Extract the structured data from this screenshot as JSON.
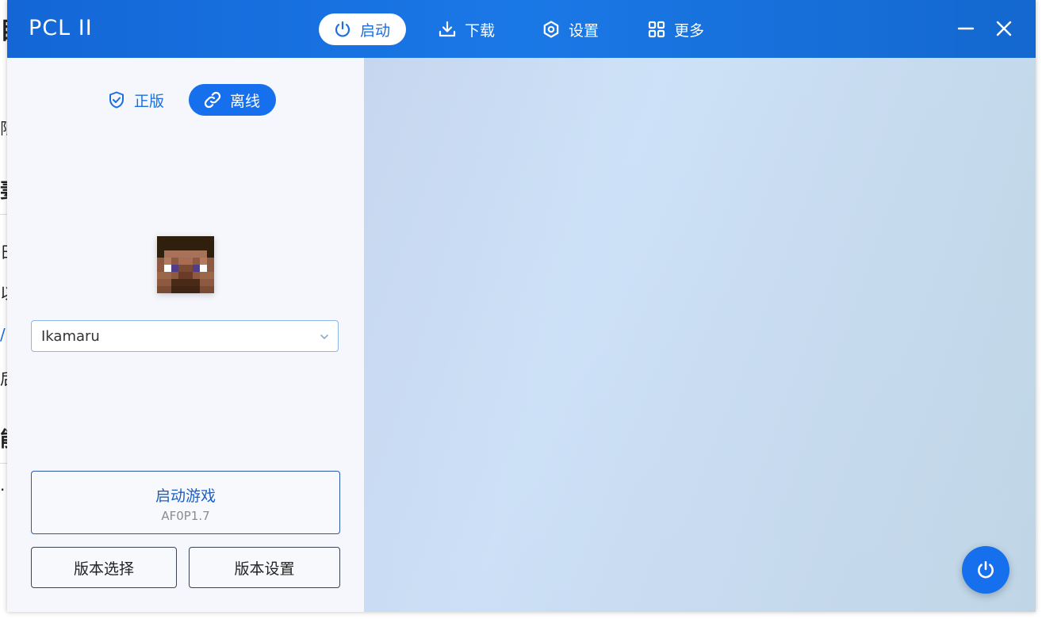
{
  "app": {
    "title": "PCL II"
  },
  "nav": {
    "items": [
      {
        "label": "启动",
        "icon": "power-icon",
        "active": true
      },
      {
        "label": "下载",
        "icon": "download-icon",
        "active": false
      },
      {
        "label": "设置",
        "icon": "settings-icon",
        "active": false
      },
      {
        "label": "更多",
        "icon": "grid-icon",
        "active": false
      }
    ]
  },
  "window_controls": {
    "minimize_icon": "minimize-icon",
    "close_icon": "close-icon"
  },
  "login": {
    "tabs": [
      {
        "label": "正版",
        "icon": "shield-check-icon",
        "active": false
      },
      {
        "label": "离线",
        "icon": "link-icon",
        "active": true
      }
    ],
    "username": "Ikamaru"
  },
  "launch": {
    "label": "启动游戏",
    "version": "AF0P1.7"
  },
  "buttons": {
    "version_select": "版本选择",
    "version_settings": "版本设置"
  },
  "background_fragments": [
    "目",
    "限",
    "妻",
    "日",
    "以",
    "/",
    "后",
    "能",
    "·"
  ],
  "colors": {
    "accent": "#1670ee",
    "titlebar": "#1a72e0",
    "link_text": "#1a6fe0"
  }
}
